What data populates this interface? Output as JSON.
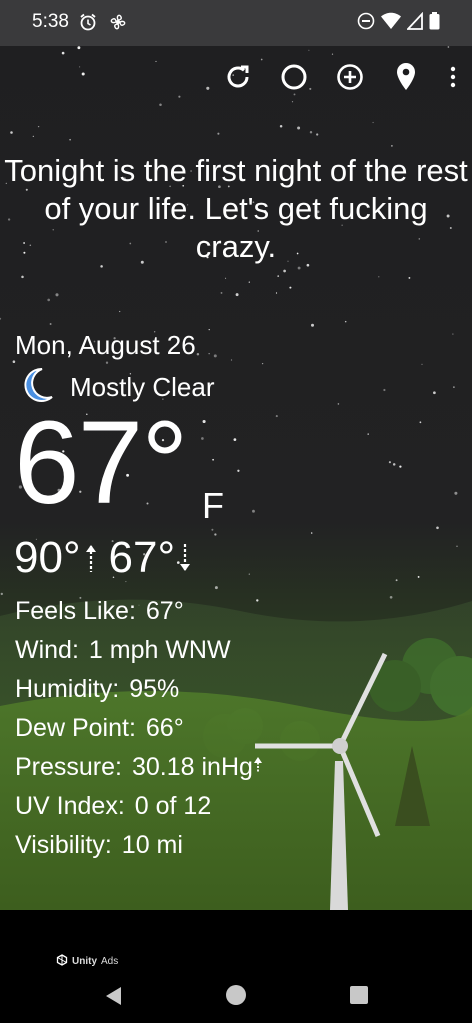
{
  "status_bar": {
    "time": "5:38",
    "left_icons": [
      "alarm-icon",
      "fan-icon"
    ],
    "right_icons": [
      "do-not-disturb-icon",
      "wifi-icon",
      "cell-signal-icon",
      "battery-icon"
    ]
  },
  "toolbar": {
    "icons": [
      "refresh-icon",
      "moon-phase-icon",
      "add-location-icon",
      "location-pin-icon",
      "more-vert-icon"
    ]
  },
  "quote": "Tonight is the first night of the rest of your life. Let's get fucking crazy.",
  "weather": {
    "date": "Mon, August 26",
    "condition": "Mostly Clear",
    "condition_icon": "crescent-moon-icon",
    "temperature": "67°",
    "unit": "F",
    "high": "90°",
    "low": "67°"
  },
  "details": [
    {
      "label": "Feels Like:",
      "value": "67°"
    },
    {
      "label": "Wind:",
      "value": "1 mph WNW"
    },
    {
      "label": "Humidity:",
      "value": "95%"
    },
    {
      "label": "Dew Point:",
      "value": "66°"
    },
    {
      "label": "Pressure:",
      "value": "30.18 inHg",
      "trend": "up"
    },
    {
      "label": "UV Index:",
      "value": "0 of 12"
    },
    {
      "label": "Visibility:",
      "value": "10 mi"
    }
  ],
  "ad": {
    "label": "Unity",
    "suffix": "Ads"
  },
  "colors": {
    "background": "#1c1c1e",
    "status_bar": "#3a3a3c",
    "moon": "#4a90e2",
    "grass": "#3b5a26",
    "text": "#ffffff"
  }
}
